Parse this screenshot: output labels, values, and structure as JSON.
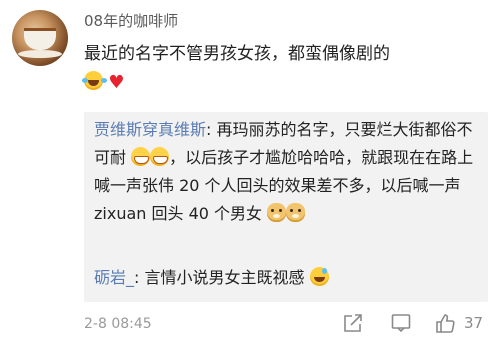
{
  "comment": {
    "username": "08年的咖啡师",
    "text": "最近的名字不管男孩女孩，都蛮偶像剧的",
    "emoji": [
      "laugh-cry-icon",
      "red-heart-icon"
    ]
  },
  "replies": [
    {
      "author": "贾维斯穿真维斯",
      "text_part1": ": 再玛丽苏的名字，只要烂大街都俗不可耐",
      "text_part2": "，以后孩子才尴尬哈哈哈，就跟现在在路上喊一声张伟 20 个人回头的效果差不多，以后喊一声 zixuan 回头 40 个男女",
      "emoji_mid": [
        "grin-icon",
        "grin-icon"
      ],
      "emoji_end": [
        "doge-icon",
        "doge-icon"
      ]
    },
    {
      "author": "砺岩_",
      "text": ": 言情小说男女主既视感",
      "emoji_end": [
        "laugh-sweat-icon"
      ]
    }
  ],
  "footer": {
    "timestamp": "2-8 08:45",
    "like_count": "37",
    "icons": [
      "share-icon",
      "comment-icon",
      "thumbs-up-icon"
    ]
  },
  "colors": {
    "author_link": "#5b7db3",
    "reply_bg": "#f2f2f2",
    "muted": "#9a9a9a"
  }
}
